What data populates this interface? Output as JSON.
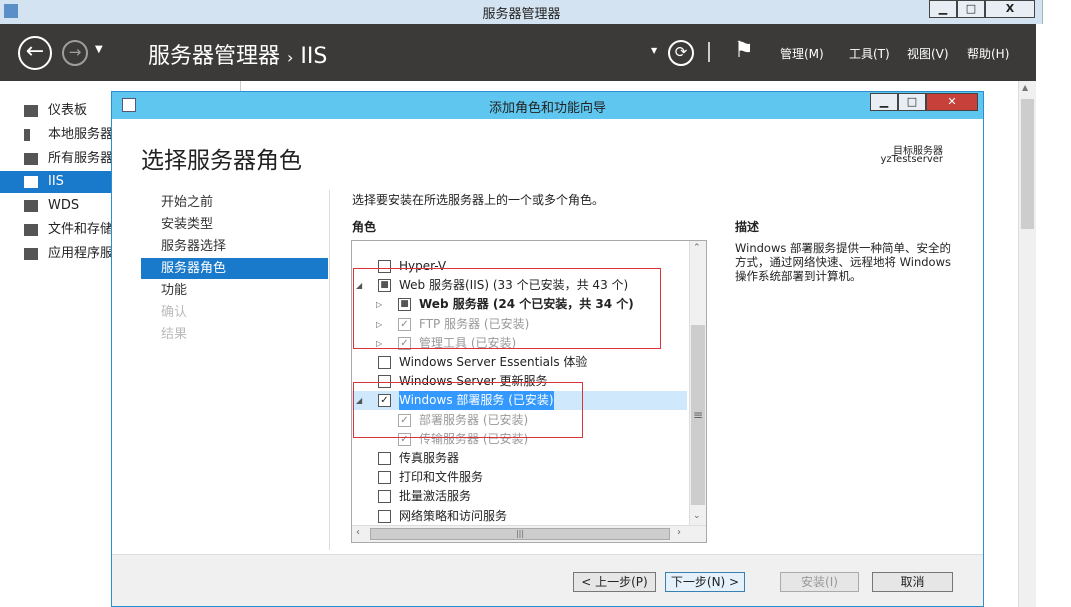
{
  "window": {
    "title": "服务器管理器",
    "min": "▁",
    "max": "□",
    "close": "X"
  },
  "header": {
    "breadcrumb_root": "服务器管理器",
    "breadcrumb_sep": "›",
    "breadcrumb_current": "IIS",
    "menus": [
      "管理(M)",
      "工具(T)",
      "视图(V)",
      "帮助(H)"
    ]
  },
  "sidebar": {
    "items": [
      {
        "label": "仪表板"
      },
      {
        "label": "本地服务器"
      },
      {
        "label": "所有服务器"
      },
      {
        "label": "IIS"
      },
      {
        "label": "WDS"
      },
      {
        "label": "文件和存储服务"
      },
      {
        "label": "应用程序服务器"
      }
    ]
  },
  "dialog": {
    "title": "添加角色和功能向导",
    "min": "▁",
    "max": "□",
    "close": "✕",
    "heading": "选择服务器角色",
    "target_label": "目标服务器",
    "target_value": "yzTestserver",
    "nav": [
      "开始之前",
      "安装类型",
      "服务器选择",
      "服务器角色",
      "功能",
      "确认",
      "结果"
    ],
    "instruction": "选择要安装在所选服务器上的一个或多个角色。",
    "roles_label": "角色",
    "roles": [
      {
        "label": "Hyper-V",
        "state": "unchecked"
      },
      {
        "label": "Web 服务器(IIS) (33 个已安装，共 43 个)",
        "state": "partial"
      },
      {
        "label": "Web 服务器 (24 个已安装，共 34 个)",
        "state": "partial"
      },
      {
        "label": "FTP 服务器 (已安装)",
        "state": "checked"
      },
      {
        "label": "管理工具 (已安装)",
        "state": "checked"
      },
      {
        "label": "Windows Server Essentials 体验",
        "state": "unchecked"
      },
      {
        "label": "Windows Server 更新服务",
        "state": "unchecked"
      },
      {
        "label": "Windows 部署服务 (已安装)",
        "state": "checked"
      },
      {
        "label": "部署服务器 (已安装)",
        "state": "checked"
      },
      {
        "label": "传输服务器 (已安装)",
        "state": "checked"
      },
      {
        "label": "传真服务器",
        "state": "unchecked"
      },
      {
        "label": "打印和文件服务",
        "state": "unchecked"
      },
      {
        "label": "批量激活服务",
        "state": "unchecked"
      },
      {
        "label": "网络策略和访问服务",
        "state": "unchecked"
      }
    ],
    "description_label": "描述",
    "description": "Windows 部署服务提供一种简单、安全的方式，通过网络快速、远程地将 Windows 操作系统部署到计算机。",
    "buttons": {
      "prev": "< 上一步(P)",
      "next": "下一步(N) >",
      "install": "安装(I)",
      "cancel": "取消"
    }
  }
}
